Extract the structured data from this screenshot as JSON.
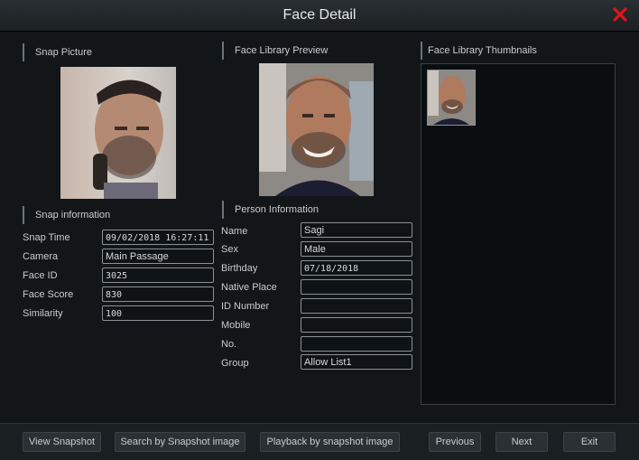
{
  "window": {
    "title": "Face Detail"
  },
  "snap_picture": {
    "section_label": "Snap Picture"
  },
  "face_library_preview": {
    "section_label": "Face Library Preview"
  },
  "face_library_thumbnails": {
    "section_label": "Face Library Thumbnails"
  },
  "snap_information": {
    "section_label": "Snap information",
    "snap_time_label": "Snap Time",
    "snap_time": "09/02/2018 16:27:11",
    "camera_label": "Camera",
    "camera": "Main Passage",
    "face_id_label": "Face ID",
    "face_id": "3025",
    "face_score_label": "Face Score",
    "face_score": "830",
    "similarity_label": "Similarity",
    "similarity": "100"
  },
  "person_information": {
    "section_label": "Person Information",
    "name_label": "Name",
    "name": "Sagi",
    "sex_label": "Sex",
    "sex": "Male",
    "birthday_label": "Birthday",
    "birthday": "07/18/2018",
    "native_place_label": "Native Place",
    "native_place": "",
    "id_number_label": "ID Number",
    "id_number": "",
    "mobile_label": "Mobile",
    "mobile": "",
    "no_label": "No.",
    "no": "",
    "group_label": "Group",
    "group": "Allow List1"
  },
  "buttons": {
    "view_snapshot": "View Snapshot",
    "search_by_snapshot": "Search by Snapshot image",
    "playback_by_snapshot": "Playback by snapshot image",
    "previous": "Previous",
    "next": "Next",
    "exit": "Exit"
  },
  "colors": {
    "close_icon": "#e0141e",
    "field_border": "#8b9196",
    "background": "#121619"
  },
  "icons": {
    "close": "close-icon"
  }
}
